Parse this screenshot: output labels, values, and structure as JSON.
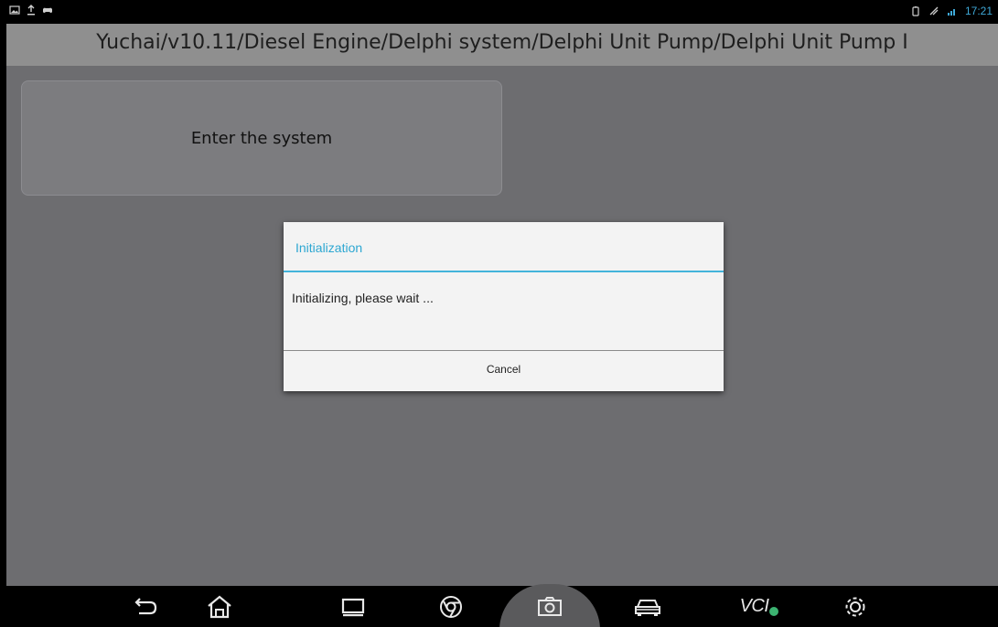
{
  "status_bar": {
    "left_icons": [
      "image-icon",
      "upload-icon",
      "gamepad-icon"
    ],
    "right_icons": [
      "battery-icon",
      "signal-icon",
      "wifi-icon"
    ],
    "time": "17:21",
    "time_color": "#3fa9d8"
  },
  "header": {
    "breadcrumb": "Yuchai/v10.11/Diesel Engine/Delphi system/Delphi Unit Pump/Delphi Unit Pump I"
  },
  "main": {
    "enter_button_label": "Enter the system"
  },
  "dialog": {
    "title": "Initialization",
    "message": "Initializing, please wait ...",
    "cancel_label": "Cancel",
    "accent_color": "#2da7d2"
  },
  "nav_bar": {
    "items": [
      "back-icon",
      "home-icon",
      "recent-apps-icon",
      "browser-icon",
      "camera-icon",
      "car-icon",
      "vci-icon",
      "settings-icon"
    ],
    "vci_label": "VCI"
  }
}
